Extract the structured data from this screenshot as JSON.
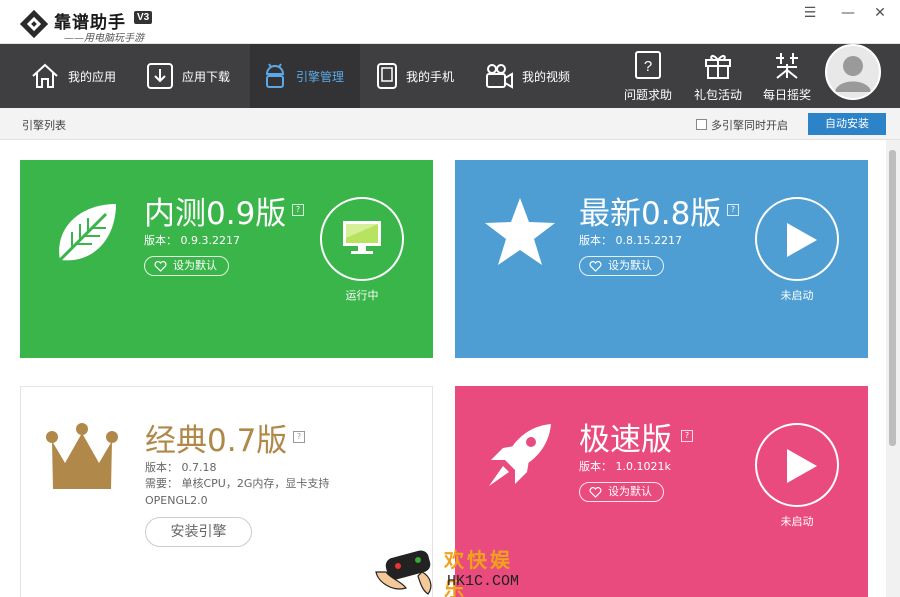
{
  "app": {
    "name": "靠谱助手",
    "version_badge": "V3",
    "slogan": "——用电脑玩手游"
  },
  "window_controls": {
    "menu": "☰",
    "minimize": "—",
    "close": "✕"
  },
  "nav": {
    "tabs": [
      {
        "label": "我的应用",
        "icon": "home-icon"
      },
      {
        "label": "应用下载",
        "icon": "download-icon"
      },
      {
        "label": "引擎管理",
        "icon": "android-icon",
        "active": true
      },
      {
        "label": "我的手机",
        "icon": "phone-icon"
      },
      {
        "label": "我的视频",
        "icon": "video-camera-icon"
      }
    ],
    "tools": [
      {
        "label": "问题求助",
        "icon": "help-icon"
      },
      {
        "label": "礼包活动",
        "icon": "gift-icon"
      },
      {
        "label": "每日摇奖",
        "icon": "lottery-icon"
      }
    ]
  },
  "subbar": {
    "breadcrumb": "引擎列表",
    "multi_engine_label": "多引擎同时开启",
    "multi_engine_checked": false,
    "auto_install_label": "自动安装"
  },
  "cards": {
    "beta": {
      "title": "内测0.9版",
      "version": "版本： 0.9.3.2217",
      "default_label": "设为默认",
      "status": "运行中",
      "color": "#3ab54a",
      "icon": "leaf-icon"
    },
    "latest": {
      "title": "最新0.8版",
      "version": "版本： 0.8.15.2217",
      "default_label": "设为默认",
      "status": "未启动",
      "color": "#4f9ed3",
      "icon": "star-icon"
    },
    "classic": {
      "title": "经典0.7版",
      "version": "版本： 0.7.18",
      "requirement": "需要： 单核CPU，2G内存，显卡支持OPENGL2.0",
      "install_label": "安装引擎",
      "color": "#b0884a",
      "icon": "crown-icon"
    },
    "speed": {
      "title": "极速版",
      "version": "版本： 1.0.1021k",
      "default_label": "设为默认",
      "status": "未启动",
      "color": "#ea4b7e",
      "icon": "rocket-icon"
    }
  },
  "watermark": {
    "cn": "欢快娱乐",
    "en": "HK1C.COM"
  }
}
